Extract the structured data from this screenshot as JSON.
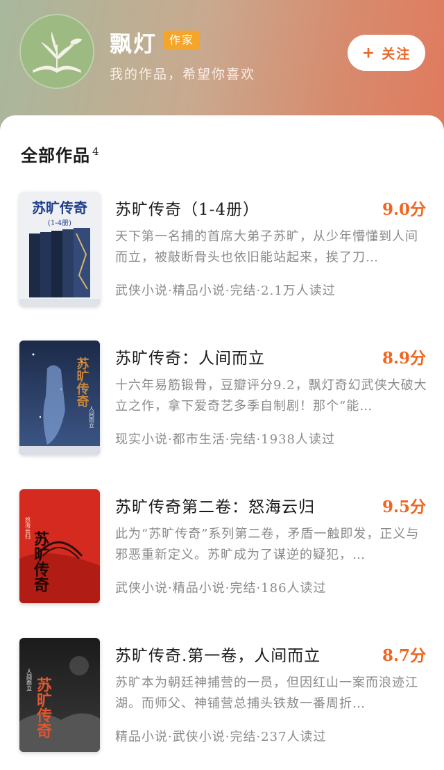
{
  "author": {
    "name": "飘灯",
    "badge": "作家",
    "subtitle": "我的作品，希望你喜欢",
    "follow_label": "关注",
    "follow_icon": "plus-icon"
  },
  "section": {
    "title": "全部作品",
    "count": "4"
  },
  "books": [
    {
      "title": "苏旷传奇（1-4册）",
      "score": "9.0分",
      "desc": "天下第一名捕的首席大弟子苏旷，从少年懵懂到人间而立，被敲断骨头也依旧能站起来，挨了刀…",
      "meta": "武侠小说·精品小说·完结·2.1万人读过",
      "cover_text": "苏旷传奇",
      "cover_sub": "(1-4册)"
    },
    {
      "title": "苏旷传奇：人间而立",
      "score": "8.9分",
      "desc": "十六年易筋锻骨，豆瓣评分9.2，飘灯奇幻武侠大破大立之作，拿下爱奇艺多季自制剧！那个“能…",
      "meta": "现实小说·都市生活·完结·1938人读过",
      "cover_text": "苏旷传奇",
      "cover_sub": "人间而立"
    },
    {
      "title": "苏旷传奇第二卷：怒海云归",
      "score": "9.5分",
      "desc": "此为“苏旷传奇”系列第二卷，矛盾一触即发，正义与邪恶重新定义。苏旷成为了谋逆的疑犯，…",
      "meta": "武侠小说·精品小说·完结·186人读过",
      "cover_text": "苏旷传奇",
      "cover_sub": "怒海云归"
    },
    {
      "title": "苏旷传奇.第一卷，人间而立",
      "score": "8.7分",
      "desc": "苏旷本为朝廷神捕营的一员，但因红山一案而浪迹江湖。而师父、神铺营总捕头铁敖一番周折…",
      "meta": "精品小说·武侠小说·完结·237人读过",
      "cover_text": "苏旷传奇",
      "cover_sub": "人间而立"
    }
  ],
  "colors": {
    "accent": "#f0651f",
    "badge": "#f5a52a",
    "muted": "#8a8a8a"
  }
}
